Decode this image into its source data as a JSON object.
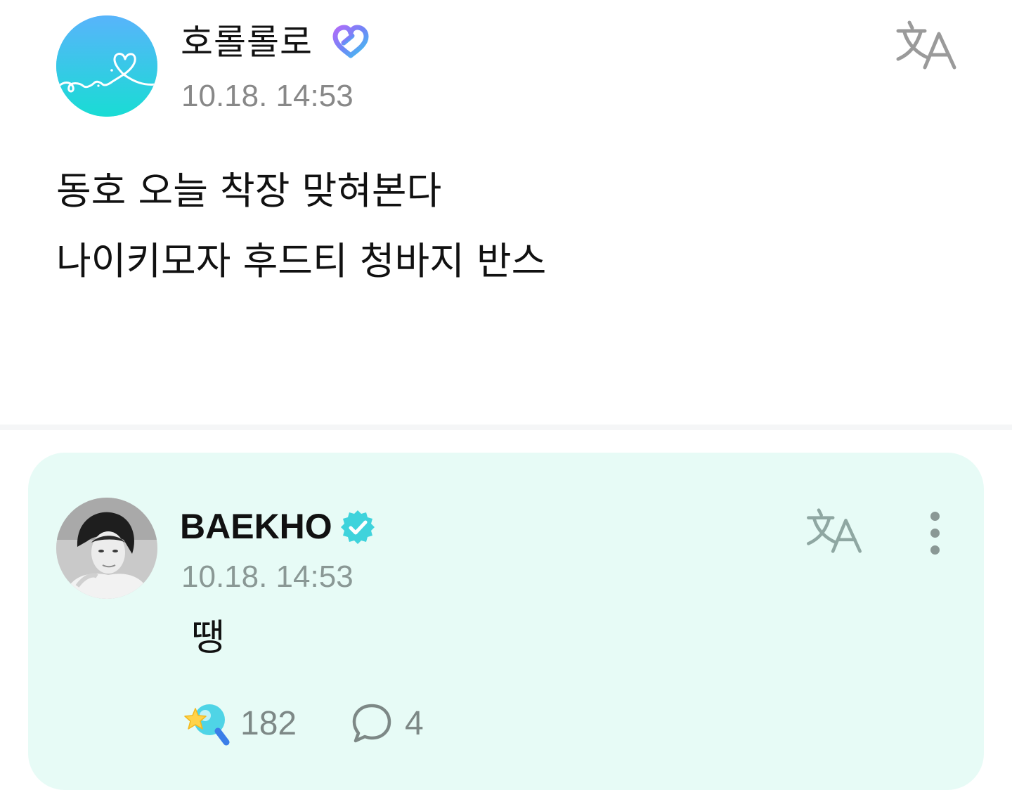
{
  "post": {
    "author_name": "호롤롤로",
    "timestamp": "10.18. 14:53",
    "body_lines": [
      "동호 오늘 착장 맞혀본다",
      "나이키모자 후드티 청바지 반스"
    ],
    "avatar_icon": "heart-doodle-avatar",
    "badge_icon": "heart-badge-icon",
    "translate_icon": "translate-icon"
  },
  "reply": {
    "author_name": "BAEKHO",
    "timestamp": "10.18. 14:53",
    "body": "땡",
    "verified_icon": "verified-badge-icon",
    "translate_icon": "translate-icon",
    "more_icon": "more-vertical-icon",
    "reaction_icon": "star-wand-icon",
    "reaction_count": "182",
    "comment_icon": "comment-bubble-icon",
    "comment_count": "4"
  },
  "colors": {
    "reply_background": "#e7fbf6",
    "timestamp_gray": "#888888",
    "verified_teal": "#3fd3dc",
    "avatar_gradient_top": "#58b4fb",
    "avatar_gradient_bottom": "#19dcd4"
  }
}
